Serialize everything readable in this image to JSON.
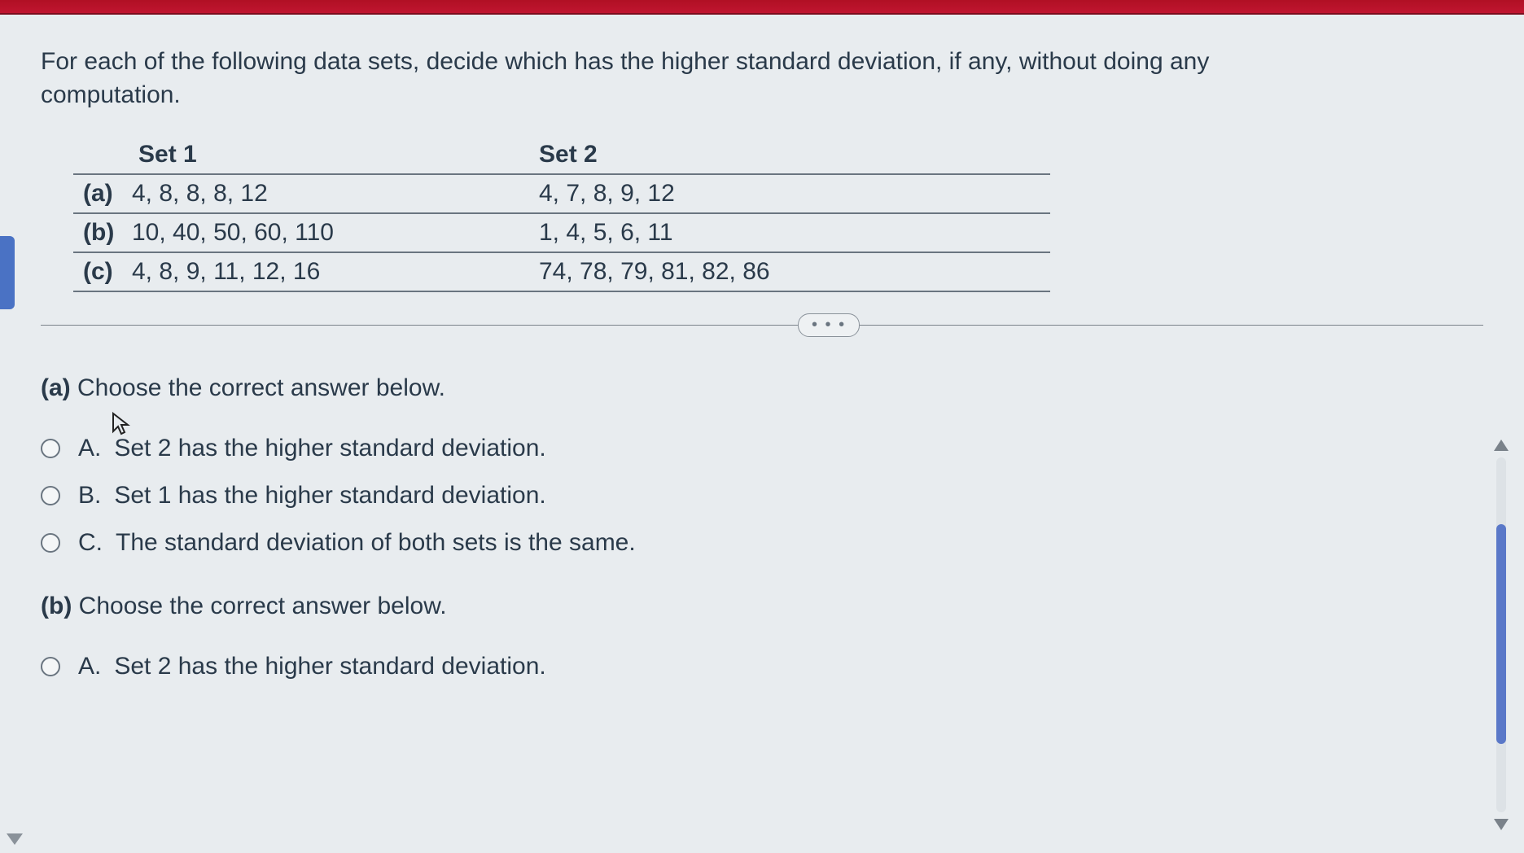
{
  "prompt": "For each of the following data sets, decide which has the higher standard deviation, if any, without doing any computation.",
  "table": {
    "headers": {
      "set1": "Set 1",
      "set2": "Set 2"
    },
    "rows": [
      {
        "label": "(a)",
        "set1": "4, 8, 8, 8, 12",
        "set2": "4, 7, 8, 9, 12"
      },
      {
        "label": "(b)",
        "set1": "10, 40, 50, 60, 110",
        "set2": "1, 4, 5, 6, 11"
      },
      {
        "label": "(c)",
        "set1": "4, 8, 9, 11, 12, 16",
        "set2": "74, 78, 79, 81, 82, 86"
      }
    ]
  },
  "ellipsis": "• • •",
  "questions": {
    "a": {
      "label": "(a)",
      "text": "Choose the correct answer below.",
      "options": [
        {
          "letter": "A.",
          "text": "Set 2 has the higher standard deviation."
        },
        {
          "letter": "B.",
          "text": "Set 1 has the higher standard deviation."
        },
        {
          "letter": "C.",
          "text": "The standard deviation of both sets is the same."
        }
      ]
    },
    "b": {
      "label": "(b)",
      "text": "Choose the correct answer below.",
      "options": [
        {
          "letter": "A.",
          "text": "Set 2 has the higher standard deviation."
        }
      ]
    }
  },
  "chart_data": {
    "type": "table",
    "title": "Data set comparison for standard deviation",
    "columns": [
      "Set 1",
      "Set 2"
    ],
    "rows": [
      {
        "label": "(a)",
        "Set 1": [
          4,
          8,
          8,
          8,
          12
        ],
        "Set 2": [
          4,
          7,
          8,
          9,
          12
        ]
      },
      {
        "label": "(b)",
        "Set 1": [
          10,
          40,
          50,
          60,
          110
        ],
        "Set 2": [
          1,
          4,
          5,
          6,
          11
        ]
      },
      {
        "label": "(c)",
        "Set 1": [
          4,
          8,
          9,
          11,
          12,
          16
        ],
        "Set 2": [
          74,
          78,
          79,
          81,
          82,
          86
        ]
      }
    ]
  }
}
